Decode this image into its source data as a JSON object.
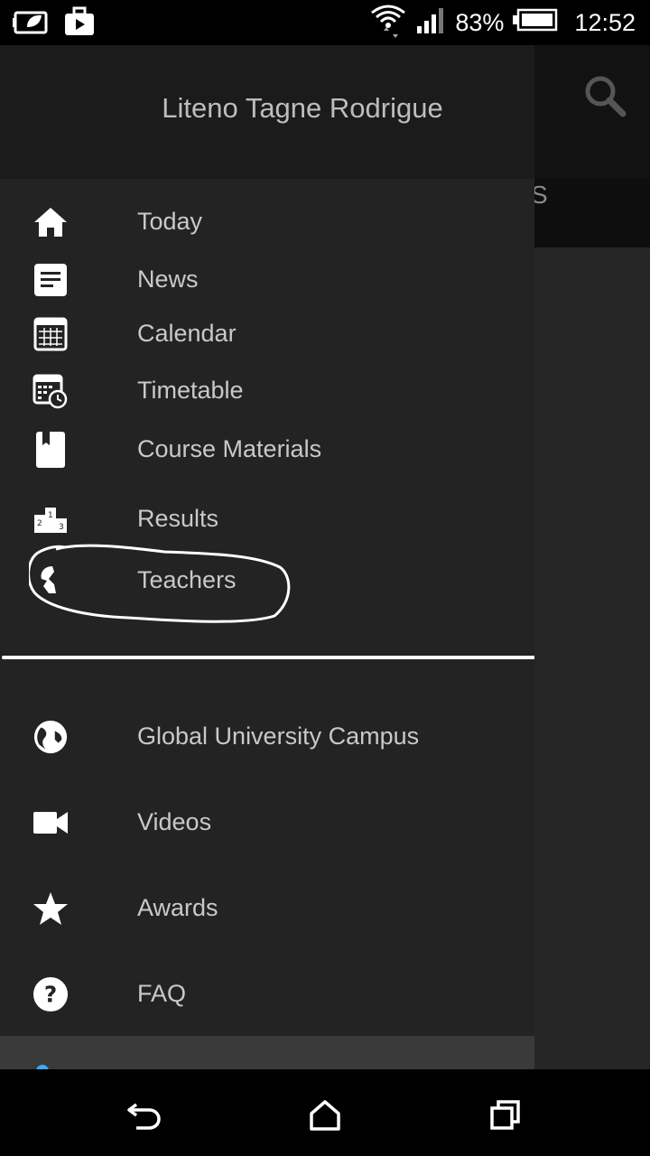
{
  "status_bar": {
    "battery_percent": "83%",
    "time": "12:52",
    "icons": [
      "leaf-battery-icon",
      "briefcase-play-icon",
      "wifi-icon",
      "signal-icon",
      "battery-icon"
    ]
  },
  "app_behind": {
    "tab_fragment": "S"
  },
  "drawer": {
    "user_name": "Liteno Tagne Rodrigue",
    "primary_items": [
      {
        "label": "Today",
        "icon": "home-icon"
      },
      {
        "label": "News",
        "icon": "news-icon"
      },
      {
        "label": "Calendar",
        "icon": "calendar-icon"
      },
      {
        "label": "Timetable",
        "icon": "timetable-icon"
      },
      {
        "label": "Course Materials",
        "icon": "book-icon"
      },
      {
        "label": "Results",
        "icon": "podium-icon"
      },
      {
        "label": "Teachers",
        "icon": "teachers-icon"
      }
    ],
    "secondary_items": [
      {
        "label": "Global University Campus",
        "icon": "globe-icon"
      },
      {
        "label": "Videos",
        "icon": "video-camera-icon"
      },
      {
        "label": "Awards",
        "icon": "star-icon"
      },
      {
        "label": "FAQ",
        "icon": "help-icon"
      }
    ]
  },
  "colors": {
    "drawer_bg": "#232323",
    "header_bg": "#1b1b1b",
    "text": "#c9c9c9",
    "accent": "#3fa9f5"
  },
  "navigation_bar": [
    "back-icon",
    "home-nav-icon",
    "recents-icon"
  ]
}
